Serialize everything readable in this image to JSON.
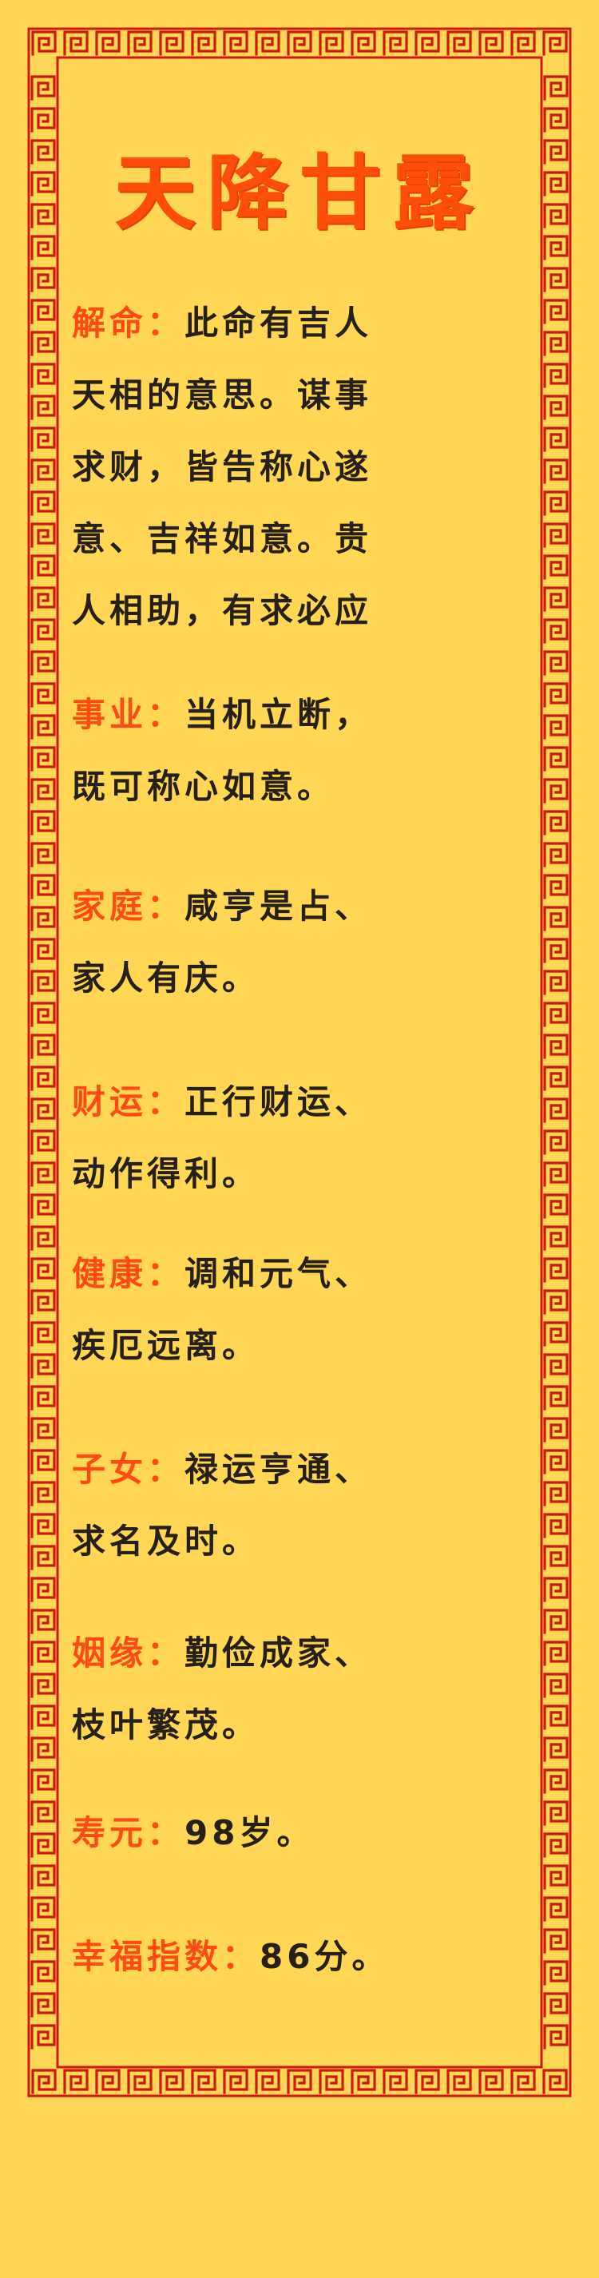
{
  "title": "天降甘露",
  "sections": [
    {
      "label": "解命：",
      "lines": [
        "此命有吉人",
        "天相的意思。谋事",
        "求财，皆告称心遂",
        "意、吉祥如意。贵",
        "人相助，有求必应"
      ]
    },
    {
      "label": "事业：",
      "lines": [
        "当机立断，",
        "既可称心如意。"
      ]
    },
    {
      "label": "家庭：",
      "lines": [
        "咸亨是占、",
        "家人有庆。"
      ]
    },
    {
      "label": "财运：",
      "lines": [
        "正行财运、",
        "动作得利。"
      ]
    },
    {
      "label": "健康：",
      "lines": [
        "调和元气、",
        "疾厄远离。"
      ]
    },
    {
      "label": "子女：",
      "lines": [
        "禄运亨通、",
        "求名及时。"
      ]
    },
    {
      "label": "姻缘：",
      "lines": [
        "勤俭成家、",
        "枝叶繁茂。"
      ]
    },
    {
      "label": "寿元：",
      "lines": [
        "98岁。"
      ]
    },
    {
      "label": "幸福指数：",
      "lines": [
        "86分。"
      ]
    }
  ],
  "colors": {
    "background": "#ffd754",
    "border": "#cc1a0a",
    "label": "#ff4a14",
    "text": "#262018",
    "title": "#ff4e0a"
  }
}
